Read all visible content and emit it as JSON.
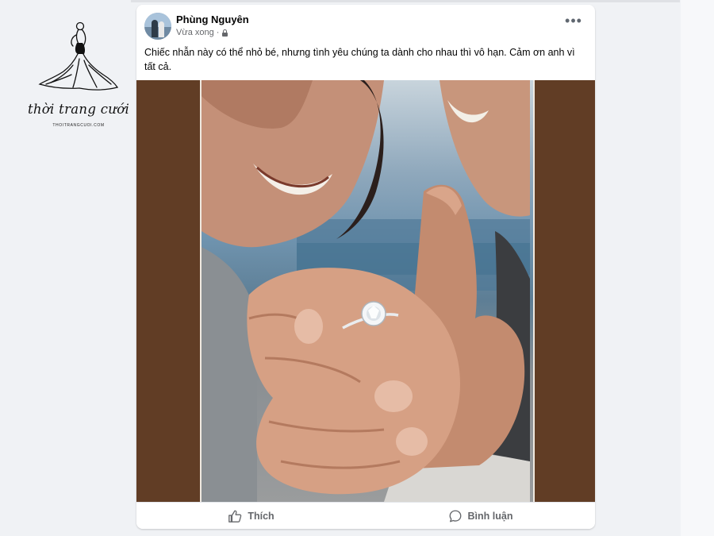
{
  "watermark": {
    "brand_script": "thời trang cưới",
    "brand_url": "THOITRANGCUOI.COM"
  },
  "post": {
    "author": "Phùng Nguyên",
    "time": "Vừa xong",
    "privacy_icon": "lock-icon",
    "more_icon": "more-options-icon",
    "more_glyph": "•••",
    "caption": "Chiếc nhẫn này có thể nhỏ bé, nhưng tình yêu chúng ta dành cho nhau thì vô hạn. Cảm ơn anh vì tất cả.",
    "photo_border_color": "#613d25"
  },
  "actions": {
    "like": {
      "label": "Thích",
      "icon": "thumbs-up-icon"
    },
    "comment": {
      "label": "Bình luận",
      "icon": "comment-bubble-icon"
    }
  }
}
